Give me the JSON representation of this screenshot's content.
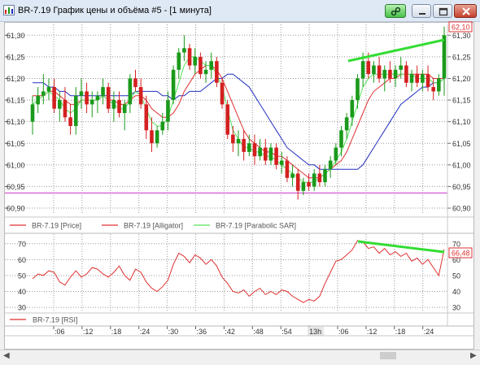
{
  "window": {
    "title": "BR-7.19 График цены и объёма #5 - [1 минута]"
  },
  "price_panel": {
    "y_ticks": [
      "61,30",
      "61,25",
      "61,20",
      "61,15",
      "61,10",
      "61,05",
      "61,00",
      "60,95",
      "60,90"
    ],
    "ylim": [
      60.885,
      61.325
    ],
    "current_price_label": "62,10",
    "legend": [
      {
        "label": "BR-7.19 [Price]",
        "color": "#e03030"
      },
      {
        "label": "BR-7.19 [Alligator]",
        "color": "#e03030"
      },
      {
        "label": "BR-7.19 [Parabolic SAR]",
        "color": "#56e35a"
      }
    ]
  },
  "rsi_panel": {
    "y_ticks": [
      "70",
      "60",
      "50",
      "40",
      "30"
    ],
    "ylim": [
      27,
      76
    ],
    "current_value_label": "66,48",
    "legend_label": "BR-7.19 [RSI]"
  },
  "time_axis": {
    "labels": [
      ":06",
      ":12",
      ":18",
      ":24",
      ":30",
      ":36",
      ":42",
      ":48",
      ":54",
      "13h",
      ":06",
      ":12",
      ":18",
      ":24"
    ]
  },
  "colors": {
    "price_line": "#e03030",
    "jaw_line": "#2030c0",
    "teeth_line": "#e03030",
    "lips_line": "#56e35a",
    "support_line": "#cc33cc",
    "trendline": "#33dd33",
    "up_candle": "#1a9a1a",
    "down_candle": "#d42020"
  },
  "chart_data": [
    {
      "type": "candlestick",
      "series": [
        {
          "name": "BR-7.19 [Price]",
          "ohlc": [
            [
              61.1,
              61.16,
              61.07,
              61.14
            ],
            [
              61.14,
              61.18,
              61.12,
              61.16
            ],
            [
              61.16,
              61.21,
              61.14,
              61.17
            ],
            [
              61.17,
              61.2,
              61.15,
              61.18
            ],
            [
              61.18,
              61.2,
              61.12,
              61.13
            ],
            [
              61.13,
              61.17,
              61.1,
              61.15
            ],
            [
              61.15,
              61.18,
              61.1,
              61.11
            ],
            [
              61.11,
              61.14,
              61.07,
              61.09
            ],
            [
              61.09,
              61.18,
              61.07,
              61.16
            ],
            [
              61.16,
              61.2,
              61.13,
              61.17
            ],
            [
              61.17,
              61.19,
              61.12,
              61.14
            ],
            [
              61.14,
              61.17,
              61.11,
              61.15
            ],
            [
              61.15,
              61.17,
              61.12,
              61.16
            ],
            [
              61.16,
              61.2,
              61.14,
              61.18
            ],
            [
              61.18,
              61.19,
              61.12,
              61.13
            ],
            [
              61.13,
              61.17,
              61.1,
              61.15
            ],
            [
              61.15,
              61.17,
              61.11,
              61.12
            ],
            [
              61.12,
              61.15,
              61.08,
              61.14
            ],
            [
              61.14,
              61.21,
              61.12,
              61.2
            ],
            [
              61.2,
              61.22,
              61.17,
              61.18
            ],
            [
              61.18,
              61.2,
              61.13,
              61.14
            ],
            [
              61.14,
              61.16,
              61.06,
              61.08
            ],
            [
              61.08,
              61.11,
              61.03,
              61.05
            ],
            [
              61.05,
              61.09,
              61.04,
              61.08
            ],
            [
              61.08,
              61.12,
              61.07,
              61.1
            ],
            [
              61.1,
              61.17,
              61.08,
              61.15
            ],
            [
              61.15,
              61.23,
              61.14,
              61.22
            ],
            [
              61.22,
              61.27,
              61.2,
              61.26
            ],
            [
              61.26,
              61.3,
              61.24,
              61.27
            ],
            [
              61.27,
              61.28,
              61.22,
              61.23
            ],
            [
              61.23,
              61.27,
              61.21,
              61.25
            ],
            [
              61.25,
              61.26,
              61.2,
              61.21
            ],
            [
              61.21,
              61.24,
              61.19,
              61.22
            ],
            [
              61.22,
              61.26,
              61.2,
              61.24
            ],
            [
              61.24,
              61.25,
              61.18,
              61.19
            ],
            [
              61.19,
              61.2,
              61.13,
              61.14
            ],
            [
              61.14,
              61.15,
              61.06,
              61.07
            ],
            [
              61.07,
              61.09,
              61.03,
              61.05
            ],
            [
              61.05,
              61.08,
              61.02,
              61.06
            ],
            [
              61.06,
              61.08,
              61.01,
              61.03
            ],
            [
              61.03,
              61.07,
              61.02,
              61.05
            ],
            [
              61.05,
              61.07,
              61.0,
              61.02
            ],
            [
              61.02,
              61.06,
              61.01,
              61.04
            ],
            [
              61.04,
              61.06,
              61.0,
              61.01
            ],
            [
              61.01,
              61.05,
              61.0,
              61.04
            ],
            [
              61.04,
              61.05,
              60.99,
              61.0
            ],
            [
              61.0,
              61.03,
              60.98,
              61.01
            ],
            [
              61.01,
              61.02,
              60.96,
              60.97
            ],
            [
              60.97,
              61.0,
              60.95,
              60.98
            ],
            [
              60.98,
              60.99,
              60.92,
              60.94
            ],
            [
              60.94,
              60.97,
              60.93,
              60.96
            ],
            [
              60.96,
              60.98,
              60.94,
              60.95
            ],
            [
              60.95,
              60.99,
              60.94,
              60.98
            ],
            [
              60.98,
              61.0,
              60.95,
              60.96
            ],
            [
              60.96,
              61.0,
              60.95,
              60.99
            ],
            [
              60.99,
              61.02,
              60.97,
              61.01
            ],
            [
              61.01,
              61.05,
              61.0,
              61.04
            ],
            [
              61.04,
              61.09,
              61.02,
              61.08
            ],
            [
              61.08,
              61.12,
              61.06,
              61.11
            ],
            [
              61.11,
              61.16,
              61.09,
              61.15
            ],
            [
              61.15,
              61.21,
              61.13,
              61.2
            ],
            [
              61.2,
              61.26,
              61.18,
              61.24
            ],
            [
              61.24,
              61.26,
              61.2,
              61.21
            ],
            [
              61.21,
              61.24,
              61.19,
              61.23
            ],
            [
              61.23,
              61.25,
              61.19,
              61.2
            ],
            [
              61.2,
              61.23,
              61.17,
              61.22
            ],
            [
              61.22,
              61.24,
              61.19,
              61.2
            ],
            [
              61.2,
              61.23,
              61.18,
              61.22
            ],
            [
              61.22,
              61.25,
              61.2,
              61.23
            ],
            [
              61.23,
              61.24,
              61.18,
              61.19
            ],
            [
              61.19,
              61.22,
              61.17,
              61.21
            ],
            [
              61.21,
              61.23,
              61.18,
              61.19
            ],
            [
              61.19,
              61.22,
              61.17,
              61.21
            ],
            [
              61.21,
              61.23,
              61.17,
              61.18
            ],
            [
              61.18,
              61.2,
              61.15,
              61.17
            ],
            [
              61.17,
              61.21,
              61.16,
              61.2
            ],
            [
              61.2,
              61.32,
              61.16,
              61.3
            ]
          ]
        },
        {
          "name": "BR-7.19 [Alligator] jaw",
          "values": [
            61.19,
            61.19,
            61.19,
            61.18,
            61.18,
            61.17,
            61.17,
            61.16,
            61.16,
            61.16,
            61.16,
            61.16,
            61.16,
            61.16,
            61.16,
            61.16,
            61.16,
            61.16,
            61.16,
            61.17,
            61.17,
            61.17,
            61.17,
            61.17,
            61.16,
            61.16,
            61.15,
            61.16,
            61.16,
            61.17,
            61.17,
            61.17,
            61.18,
            61.19,
            61.2,
            61.2,
            61.21,
            61.21,
            61.2,
            61.19,
            61.18,
            61.16,
            61.14,
            61.12,
            61.1,
            61.08,
            61.06,
            61.04,
            61.03,
            61.02,
            61.01,
            61.0,
            61.0,
            60.99,
            60.99,
            60.99,
            60.99,
            60.99,
            60.99,
            60.99,
            60.99,
            61.0,
            61.02,
            61.04,
            61.06,
            61.08,
            61.1,
            61.12,
            61.14,
            61.15,
            61.16,
            61.17,
            61.18,
            61.18,
            61.19,
            61.19,
            61.2
          ]
        },
        {
          "name": "BR-7.19 [Alligator] teeth",
          "values": [
            61.16,
            61.16,
            61.16,
            61.17,
            61.17,
            61.16,
            61.15,
            61.14,
            61.14,
            61.15,
            61.15,
            61.15,
            61.15,
            61.16,
            61.15,
            61.15,
            61.14,
            61.14,
            61.15,
            61.16,
            61.16,
            61.15,
            61.13,
            61.12,
            61.11,
            61.11,
            61.12,
            61.14,
            61.17,
            61.19,
            61.21,
            61.22,
            61.23,
            61.23,
            61.22,
            61.2,
            61.17,
            61.14,
            61.11,
            61.08,
            61.06,
            61.05,
            61.04,
            61.03,
            61.03,
            61.02,
            61.02,
            61.01,
            61.0,
            60.99,
            60.98,
            60.97,
            60.97,
            60.97,
            60.98,
            60.99,
            61.0,
            61.01,
            61.03,
            61.06,
            61.09,
            61.12,
            61.15,
            61.17,
            61.18,
            61.19,
            61.2,
            61.2,
            61.21,
            61.21,
            61.21,
            61.21,
            61.21,
            61.21,
            61.2,
            61.2,
            61.2
          ]
        },
        {
          "name": "BR-7.19 [Alligator] lips",
          "values": [
            61.14,
            61.15,
            61.16,
            61.17,
            61.16,
            61.15,
            61.13,
            61.12,
            61.13,
            61.15,
            61.15,
            61.15,
            61.15,
            61.16,
            61.15,
            61.14,
            61.13,
            61.13,
            61.15,
            61.17,
            61.16,
            61.13,
            61.1,
            61.09,
            61.09,
            61.11,
            61.15,
            61.19,
            61.23,
            61.25,
            61.25,
            61.24,
            61.23,
            61.23,
            61.21,
            61.18,
            61.13,
            61.08,
            61.06,
            61.04,
            61.04,
            61.03,
            61.03,
            61.02,
            61.02,
            61.01,
            61.0,
            60.99,
            60.98,
            60.97,
            60.96,
            60.96,
            60.96,
            60.97,
            60.98,
            60.99,
            61.01,
            61.03,
            61.06,
            61.1,
            61.14,
            61.18,
            61.2,
            61.21,
            61.21,
            61.21,
            61.21,
            61.21,
            61.21,
            61.21,
            61.21,
            61.2,
            61.2,
            61.2,
            61.19,
            61.19,
            61.2
          ]
        },
        {
          "name": "support",
          "values": [
            60.935
          ]
        }
      ]
    },
    {
      "type": "line",
      "series": [
        {
          "name": "BR-7.19 [RSI]",
          "values": [
            48,
            51,
            50,
            53,
            52,
            46,
            44,
            49,
            53,
            49,
            51,
            55,
            54,
            51,
            49,
            52,
            56,
            50,
            47,
            54,
            52,
            46,
            42,
            40,
            43,
            47,
            57,
            64,
            62,
            58,
            63,
            61,
            57,
            60,
            56,
            49,
            45,
            40,
            39,
            41,
            37,
            40,
            42,
            38,
            40,
            38,
            41,
            40,
            37,
            35,
            33,
            35,
            34,
            37,
            45,
            52,
            59,
            60,
            63,
            66,
            72,
            71,
            67,
            68,
            64,
            67,
            63,
            65,
            62,
            64,
            59,
            61,
            57,
            60,
            55,
            50,
            66.48
          ]
        }
      ]
    }
  ]
}
